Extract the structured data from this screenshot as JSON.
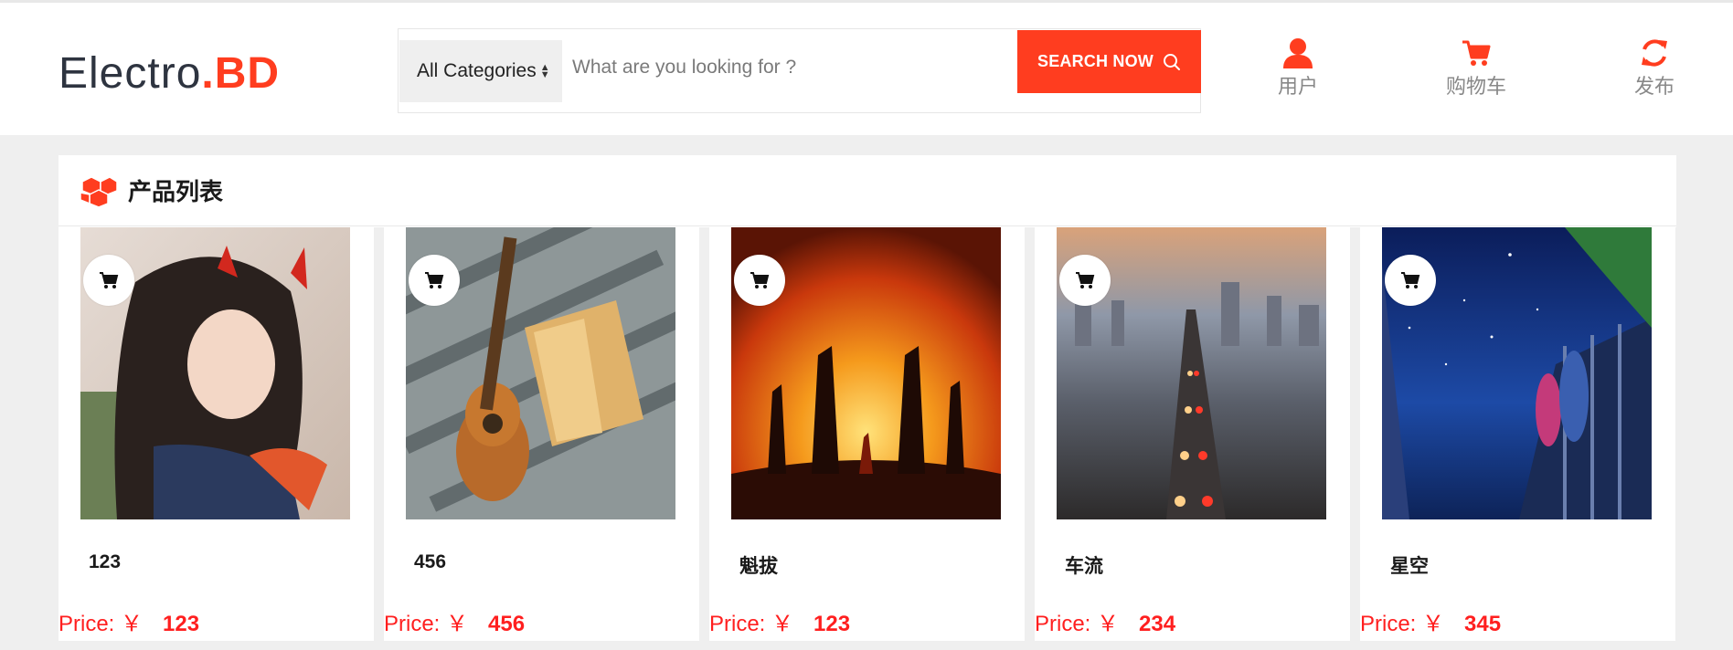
{
  "header": {
    "logo_part1": "Electro",
    "logo_part2": ".BD",
    "category_select": "All Categories",
    "search_placeholder": "What are you looking for ?",
    "search_button": "SEARCH NOW",
    "nav": [
      {
        "label": "用户",
        "icon": "user-icon"
      },
      {
        "label": "购物车",
        "icon": "cart-icon"
      },
      {
        "label": "发布",
        "icon": "refresh-icon"
      }
    ]
  },
  "section": {
    "title": "产品列表",
    "icon": "boxes-icon"
  },
  "products": [
    {
      "name": "123",
      "price_label": "Price: ￥",
      "price": "123"
    },
    {
      "name": "456",
      "price_label": "Price: ￥",
      "price": "456"
    },
    {
      "name": "魁拔",
      "price_label": "Price: ￥",
      "price": "123"
    },
    {
      "name": "车流",
      "price_label": "Price: ￥",
      "price": "234"
    },
    {
      "name": "星空",
      "price_label": "Price: ￥",
      "price": "345"
    }
  ],
  "colors": {
    "accent": "#ff3d1f",
    "price": "#ff1f1f",
    "background": "#efefef"
  }
}
